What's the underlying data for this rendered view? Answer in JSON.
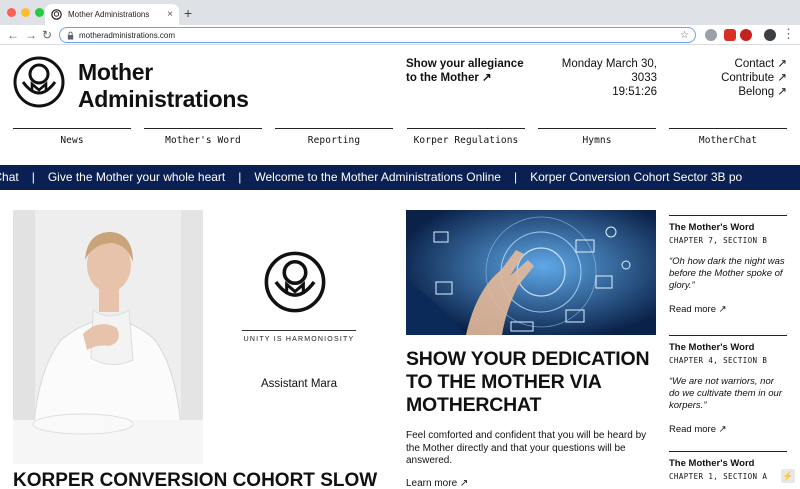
{
  "browser": {
    "tab_title": "Mother Administrations",
    "tab_close": "×",
    "new_tab": "+",
    "url": "motheradministrations.com",
    "back": "←",
    "forward": "→",
    "reload": "↻",
    "star": "☆"
  },
  "header": {
    "brand_line1": "Mother",
    "brand_line2": "Administrations",
    "allegiance_line1": "Show your allegiance",
    "allegiance_line2": "to the Mother ↗",
    "date_line1": "Monday March 30,",
    "date_line2": "3033",
    "time": "19:51:26",
    "links": [
      "Contact ↗",
      "Contribute ↗",
      "Belong ↗"
    ]
  },
  "nav": [
    "News",
    "Mother's Word",
    "Reporting",
    "Korper Regulations",
    "Hymns",
    "MotherChat"
  ],
  "ticker": {
    "items": [
      "otherChat",
      "Give the Mother your whole heart",
      "Welcome to the Mother Administrations Online",
      "Korper Conversion Cohort Sector 3B po"
    ],
    "separator": "|"
  },
  "promo": {
    "motto": "UNITY IS HARMONIOSITY",
    "name": "Assistant Mara"
  },
  "headline_bottom": "KORPER CONVERSION COHORT SLOW",
  "article": {
    "title": "SHOW YOUR DEDICATION TO THE MOTHER VIA MOTHERCHAT",
    "body": "Feel comforted and confident that you will be heard by the Mother directly and that your questions will be answered.",
    "link": "Learn more ↗"
  },
  "sidebar": [
    {
      "title": "The Mother's Word",
      "sub": "CHAPTER 7, SECTION B",
      "quote": "“Oh how dark the night was before the Mother spoke of glory.”",
      "link": "Read more ↗"
    },
    {
      "title": "The Mother's Word",
      "sub": "CHAPTER 4, SECTION B",
      "quote": "“We are not warriors, nor do we cultivate them in our korpers.”",
      "link": "Read more ↗"
    },
    {
      "title": "The Mother's Word",
      "sub": "CHAPTER 1, SECTION A",
      "quote": "",
      "link": ""
    }
  ],
  "colors": {
    "ticker_bg": "#0b2052",
    "accent_blue": "#1a4fa0"
  }
}
